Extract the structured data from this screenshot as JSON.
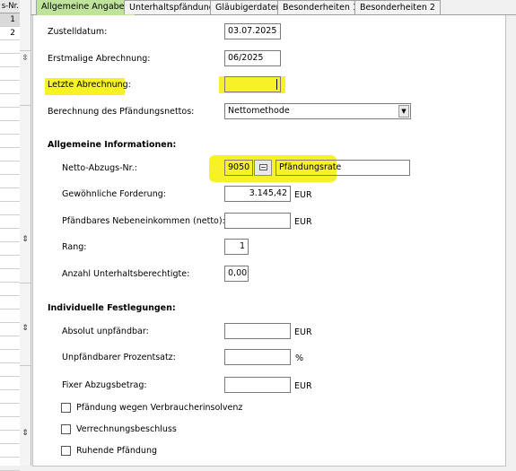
{
  "left_list": {
    "header": "s-Nr.",
    "rows": [
      "1",
      "2"
    ]
  },
  "tabs": [
    {
      "label": "Allgemeine Angaben",
      "active": true
    },
    {
      "label": "Unterhaltspfändung",
      "active": false
    },
    {
      "label": "Gläubigerdaten",
      "active": false
    },
    {
      "label": "Besonderheiten 1",
      "active": false
    },
    {
      "label": "Besonderheiten 2",
      "active": false
    }
  ],
  "form": {
    "zustelldatum": {
      "label": "Zustelldatum:",
      "value": "03.07.2025"
    },
    "erstmalige": {
      "label": "Erstmalige Abrechnung:",
      "value": "06/2025"
    },
    "letzte": {
      "label": "Letzte Abrechnung:",
      "value": ""
    },
    "berechnung": {
      "label": "Berechnung des Pfändungsnettos:",
      "value": "Nettomethode"
    }
  },
  "sections": {
    "allgemeine": "Allgemeine Informationen:",
    "individuelle": "Individuelle Festlegungen:"
  },
  "info": {
    "netto_abzugs": {
      "label": "Netto-Abzugs-Nr.:",
      "value": "9050",
      "description": "Pfändungsrate"
    },
    "forderung": {
      "label": "Gewöhnliche Forderung:",
      "value": "3.145,42",
      "unit": "EUR"
    },
    "nebeneinkommen": {
      "label": "Pfändbares Nebeneinkommen (netto):",
      "value": "",
      "unit": "EUR"
    },
    "rang": {
      "label": "Rang:",
      "value": "1"
    },
    "unterhaltsberechtigte": {
      "label": "Anzahl Unterhaltsberechtigte:",
      "value": "0,00"
    }
  },
  "individual": {
    "absolut": {
      "label": "Absolut unpfändbar:",
      "value": "",
      "unit": "EUR"
    },
    "prozentsatz": {
      "label": "Unpfändbarer Prozentsatz:",
      "value": "",
      "unit": "%"
    },
    "fixer": {
      "label": "Fixer Abzugsbetrag:",
      "value": "",
      "unit": "EUR"
    }
  },
  "checkboxes": [
    {
      "label": "Pfändung wegen Verbraucherinsolvenz",
      "checked": false
    },
    {
      "label": "Verrechnungsbeschluss",
      "checked": false
    },
    {
      "label": "Ruhende Pfändung",
      "checked": false
    }
  ],
  "colors": {
    "active_tab": "#bfe39a",
    "highlight": "#f5f000"
  }
}
